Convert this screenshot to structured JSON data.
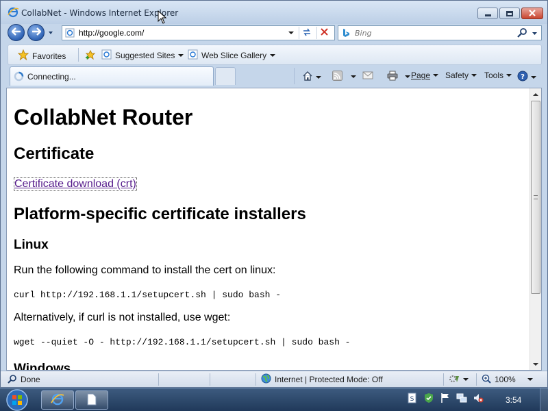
{
  "window": {
    "title": "CollabNet - Windows Internet Explorer"
  },
  "nav": {
    "address": "http://google.com/",
    "search_placeholder": "Bing"
  },
  "favorites_bar": {
    "favorites_label": "Favorites",
    "suggested_sites_label": "Suggested Sites",
    "web_slice_gallery_label": "Web Slice Gallery"
  },
  "tab": {
    "label": "Connecting..."
  },
  "command_bar": {
    "page_label": "Page",
    "safety_label": "Safety",
    "tools_label": "Tools"
  },
  "page": {
    "h1": "CollabNet Router",
    "certificate_heading": "Certificate",
    "certificate_link": "Certificate download (crt)",
    "installers_heading": "Platform-specific certificate installers",
    "linux_heading": "Linux",
    "linux_text": "Run the following command to install the cert on linux:",
    "curl_command": "curl http://192.168.1.1/setupcert.sh | sudo bash -",
    "alt_text": "Alternatively, if curl is not installed, use wget:",
    "wget_command": "wget --quiet -O - http://192.168.1.1/setupcert.sh | sudo bash -",
    "windows_heading": "Windows"
  },
  "status_bar": {
    "status": "Done",
    "zone": "Internet | Protected Mode: Off",
    "zoom": "100%"
  },
  "taskbar": {
    "clock": "3:54"
  },
  "colors": {
    "visited_link": "#551a8b",
    "frame": "#c5d6ea",
    "taskbar": "#2b4568"
  },
  "icons": [
    "ie-icon",
    "back-arrow-icon",
    "forward-arrow-icon",
    "refresh-icon",
    "stop-icon",
    "bing-icon",
    "search-icon",
    "favorites-star-icon",
    "suggested-sites-icon",
    "web-slice-icon",
    "loading-spinner-icon",
    "home-icon",
    "rss-feed-icon",
    "read-mail-icon",
    "print-icon",
    "help-icon",
    "globe-icon",
    "zoom-icon",
    "start-orb-icon",
    "document-icon"
  ]
}
